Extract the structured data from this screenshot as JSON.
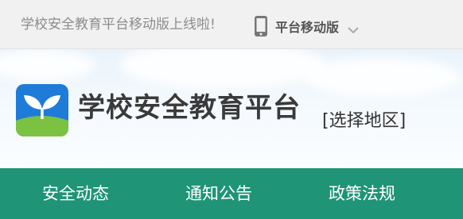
{
  "topbar": {
    "announcement": "学校安全教育平台移动版上线啦!",
    "mobile_link_label": "平台移动版",
    "phone_icon": "phone-icon",
    "dropdown_icon": "chevron-down-icon"
  },
  "header": {
    "site_title": "学校安全教育平台",
    "region_select_label": "[选择地区]",
    "logo_icon": "sprout-logo-icon"
  },
  "nav": {
    "items": [
      {
        "label": "安全动态"
      },
      {
        "label": "通知公告"
      },
      {
        "label": "政策法规"
      }
    ]
  },
  "colors": {
    "nav_background": "#1f9477",
    "logo_blue": "#1f7bd8",
    "logo_green": "#7cc242",
    "topbar_background": "#f1f1f1"
  }
}
